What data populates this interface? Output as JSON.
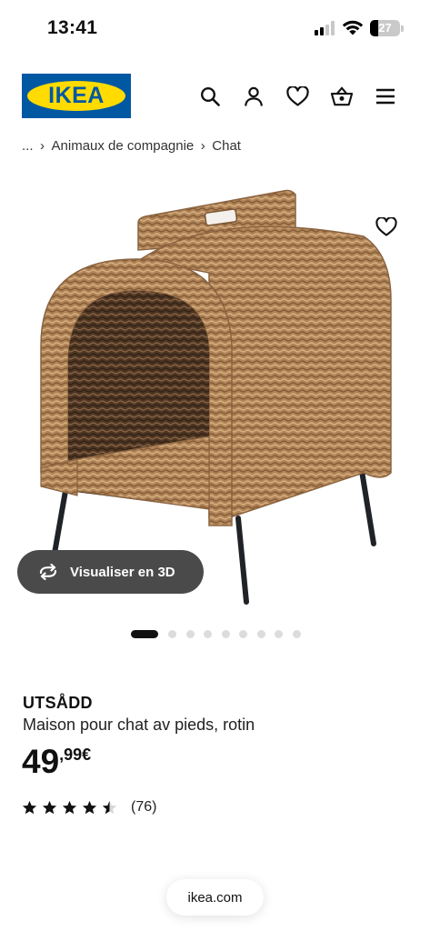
{
  "status_bar": {
    "time": "13:41",
    "battery": "27"
  },
  "header": {
    "logo_text": "IKEA"
  },
  "breadcrumb": {
    "ellipsis": "...",
    "items": [
      "Animaux de compagnie",
      "Chat"
    ]
  },
  "gallery": {
    "view_3d_label": "Visualiser en 3D",
    "slide_count": 10,
    "active_slide": 1
  },
  "product": {
    "name": "UTSÅDD",
    "description": "Maison pour chat av pieds, rotin",
    "price_int": "49",
    "price_dec": ",99€",
    "rating_value": 4.5,
    "rating_count": "(76)"
  },
  "browser": {
    "url": "ikea.com"
  },
  "colors": {
    "ikea_blue": "#0058a3",
    "ikea_yellow": "#ffdb00",
    "wicker": "#b08457",
    "button_dark": "#4a4a4a"
  }
}
